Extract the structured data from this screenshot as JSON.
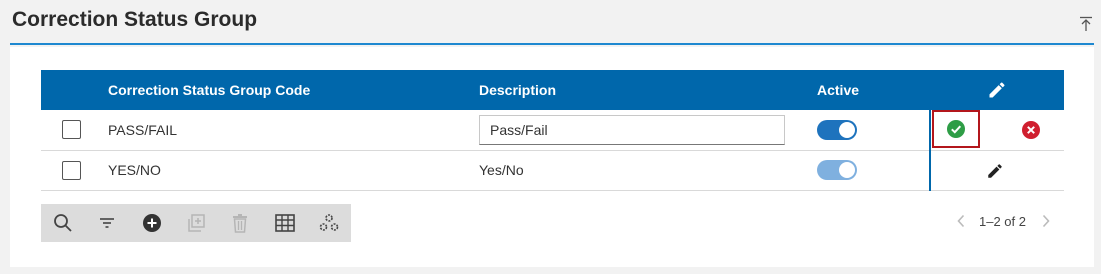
{
  "page": {
    "title": "Correction Status Group"
  },
  "grid": {
    "columns": {
      "code": "Correction Status Group Code",
      "description": "Description",
      "active": "Active"
    },
    "rows": [
      {
        "code": "PASS/FAIL",
        "description": "Pass/Fail",
        "active": true,
        "editing": true
      },
      {
        "code": "YES/NO",
        "description": "Yes/No",
        "active": true,
        "editing": false
      }
    ]
  },
  "pager": {
    "range": "1–2 of 2"
  },
  "colors": {
    "header_bg": "#0067ab",
    "accent": "#1e88d0",
    "confirm": "#2e9d46",
    "cancel": "#d01f2f",
    "highlight_border": "#b3161c"
  },
  "icons": {
    "collapse": "collapse-up-icon",
    "header_edit": "pencil-icon",
    "confirm": "check-circle-icon",
    "cancel": "close-circle-icon",
    "row_edit": "pencil-icon",
    "toolbar": [
      "search-icon",
      "filter-icon",
      "add-circle-icon",
      "copy-icon",
      "delete-icon",
      "columns-icon",
      "settings-icon"
    ],
    "pager": [
      "chevron-left-icon",
      "chevron-right-icon"
    ]
  }
}
